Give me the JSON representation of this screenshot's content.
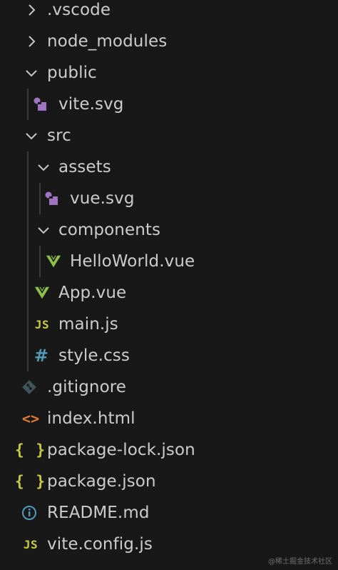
{
  "explorer": {
    "items": [
      {
        "label": ".vscode",
        "icon": "chevron-right-icon"
      },
      {
        "label": "node_modules",
        "icon": "chevron-right-icon"
      },
      {
        "label": "public",
        "icon": "chevron-down-icon"
      },
      {
        "label": "vite.svg",
        "icon": "svg-file-icon"
      },
      {
        "label": "src",
        "icon": "chevron-down-icon"
      },
      {
        "label": "assets",
        "icon": "chevron-down-icon"
      },
      {
        "label": "vue.svg",
        "icon": "svg-file-icon"
      },
      {
        "label": "components",
        "icon": "chevron-down-icon"
      },
      {
        "label": "HelloWorld.vue",
        "icon": "vue-file-icon"
      },
      {
        "label": "App.vue",
        "icon": "vue-file-icon"
      },
      {
        "label": "main.js",
        "icon": "js-file-icon"
      },
      {
        "label": "style.css",
        "icon": "css-file-icon"
      },
      {
        "label": ".gitignore",
        "icon": "git-file-icon"
      },
      {
        "label": "index.html",
        "icon": "html-file-icon"
      },
      {
        "label": "package-lock.json",
        "icon": "json-file-icon"
      },
      {
        "label": "package.json",
        "icon": "json-file-icon"
      },
      {
        "label": "README.md",
        "icon": "info-icon"
      },
      {
        "label": "vite.config.js",
        "icon": "js-file-icon"
      }
    ],
    "icon_text": {
      "js": "JS",
      "css": "#",
      "json": "{ }",
      "html": "<>"
    }
  },
  "colors": {
    "background": "#181818",
    "text": "#cccccc",
    "svg_icon": "#a074c4",
    "vue_green": "#8dc149",
    "js_yellow": "#cbcb41",
    "css_blue": "#519aba",
    "html_orange": "#e37933",
    "info_blue": "#519aba",
    "git_gray": "#41535b"
  },
  "watermark": "@稀土掘金技术社区"
}
